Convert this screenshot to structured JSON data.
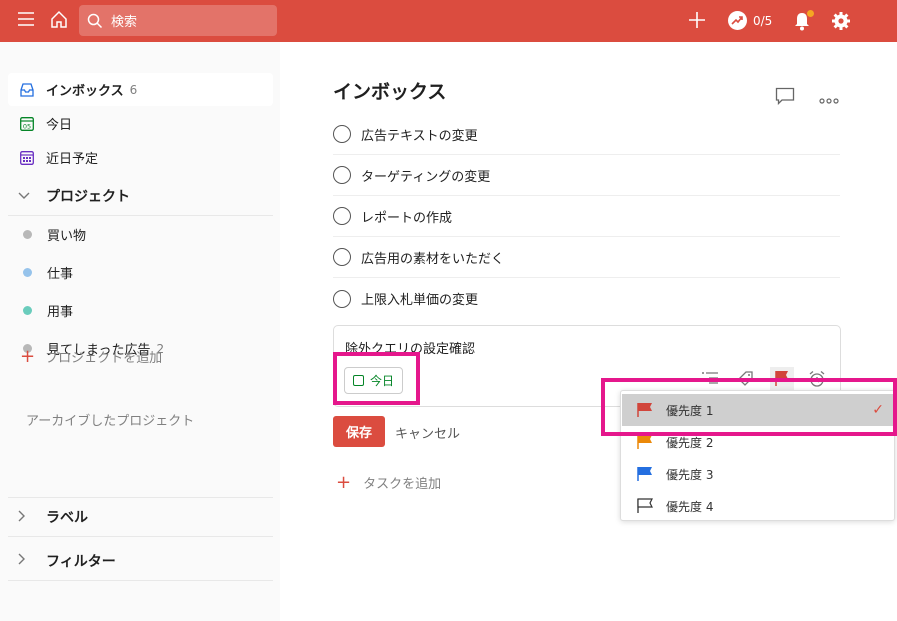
{
  "topbar": {
    "search_placeholder": "検索",
    "karma": "0/5"
  },
  "sidebar": {
    "inbox": {
      "label": "インボックス",
      "count": "6"
    },
    "today": {
      "label": "今日",
      "icon_text": "05"
    },
    "upcoming": {
      "label": "近日予定"
    },
    "projects_header": "プロジェクト",
    "projects": [
      {
        "label": "買い物",
        "color": "#b8b8b8"
      },
      {
        "label": "仕事",
        "color": "#96c3eb"
      },
      {
        "label": "用事",
        "color": "#6accbc"
      },
      {
        "label": "見てしまった広告",
        "count": "2",
        "color": "#b8b8b8"
      }
    ],
    "add_project": "プロジェクトを追加",
    "archived": "アーカイブしたプロジェクト",
    "labels_header": "ラベル",
    "filters_header": "フィルター"
  },
  "main": {
    "title": "インボックス",
    "tasks": [
      "広告テキストの変更",
      "ターゲティングの変更",
      "レポートの作成",
      "広告用の素材をいただく",
      "上限入札単価の変更"
    ],
    "editor_text": "除外クエリの設定確認",
    "date_chip": "今日",
    "save": "保存",
    "cancel": "キャンセル",
    "add_task": "タスクを追加"
  },
  "priority_menu": [
    {
      "label": "優先度 1",
      "color": "#d1453b",
      "selected": true
    },
    {
      "label": "優先度 2",
      "color": "#eb8909",
      "selected": false
    },
    {
      "label": "優先度 3",
      "color": "#246fe0",
      "selected": false
    },
    {
      "label": "優先度 4",
      "color": "#ffffff",
      "selected": false
    }
  ],
  "colors": {
    "brand": "#db4c3f",
    "highlight": "#e5178c",
    "today_green": "#058527"
  }
}
